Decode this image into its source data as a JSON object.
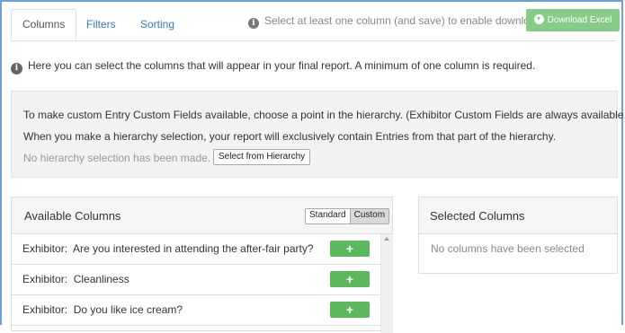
{
  "tabs": [
    {
      "label": "Columns",
      "active": true
    },
    {
      "label": "Filters",
      "active": false
    },
    {
      "label": "Sorting",
      "active": false
    }
  ],
  "download_hint": "Select at least one column (and save) to enable download",
  "download_button": "Download Excel",
  "intro_text": "Here you can select the columns that will appear in your final report. A minimum of one column is required.",
  "hierarchy": {
    "line1": "To make custom Entry Custom Fields available, choose a point in the hierarchy. (Exhibitor Custom Fields are always available.)",
    "line2": "When you make a hierarchy selection, your report will exclusively contain Entries from that part of the hierarchy.",
    "status": "No hierarchy selection has been made.",
    "button": "Select from Hierarchy"
  },
  "available": {
    "title": "Available Columns",
    "toggle": [
      "Standard",
      "Custom"
    ],
    "toggle_selected": "Custom",
    "rows": [
      {
        "label": "Exhibitor:  Are you interested in attending the after-fair party?",
        "add": "+"
      },
      {
        "label": "Exhibitor:  Cleanliness",
        "add": "+"
      },
      {
        "label": "Exhibitor:  Do you like ice cream?",
        "add": "+"
      }
    ]
  },
  "selected": {
    "title": "Selected Columns",
    "empty_text": "No columns have been selected"
  },
  "colors": {
    "tab_link": "#337ab7",
    "add_button": "#5cb85c",
    "download_button_disabled": "#86cc86",
    "frame_border": "#6f9fd8"
  },
  "icons": [
    "info-icon",
    "cloud-download-icon",
    "plus-icon",
    "scroll-up-arrow-icon"
  ]
}
